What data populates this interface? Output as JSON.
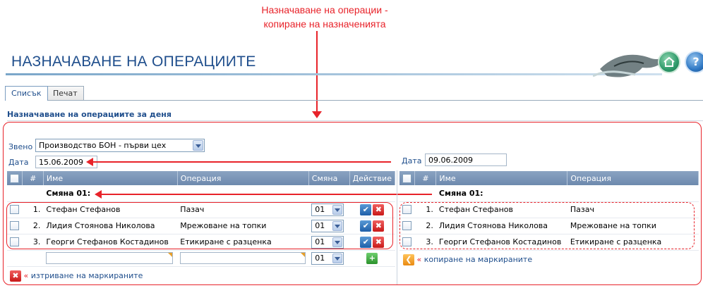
{
  "annotation": {
    "line1": "Назначаване на операции -",
    "line2": "копиране на назначенията"
  },
  "header": {
    "title": "НАЗНАЧАВАНЕ НА ОПЕРАЦИИТЕ",
    "home_icon": "home-icon",
    "help_icon": "?"
  },
  "tabs": [
    {
      "label": "Списък",
      "active": true
    },
    {
      "label": "Печат",
      "active": false
    }
  ],
  "section_title": "Назначаване на операциите за деня",
  "filters": {
    "unit_label": "Звено",
    "unit_value": "Производство БОН - първи цех",
    "date_label": "Дата",
    "date_value": "15.06.2009"
  },
  "left_table": {
    "columns": [
      "#",
      "Име",
      "Операция",
      "Смяна",
      "Действие"
    ],
    "group_label": "Смяна 01:",
    "rows": [
      {
        "num": "1.",
        "name": "Стефан Стефанов",
        "operation": "Пазач",
        "shift": "01"
      },
      {
        "num": "2.",
        "name": "Лидия Стоянова Николова",
        "operation": "Мрежоване на топки",
        "shift": "01"
      },
      {
        "num": "3.",
        "name": "Георги Стефанов Костадинов",
        "operation": "Етикиране с разценка",
        "shift": "01"
      }
    ],
    "new_row_shift": "01",
    "delete_link": "изтриване на маркираните",
    "quote": "«"
  },
  "right_panel": {
    "date_label": "Дата",
    "date_value": "09.06.2009",
    "columns": [
      "#",
      "Име",
      "Операция"
    ],
    "group_label": "Смяна 01:",
    "rows": [
      {
        "num": "1.",
        "name": "Стефан Стефанов",
        "operation": "Пазач"
      },
      {
        "num": "2.",
        "name": "Лидия Стоянова Николова",
        "operation": "Мрежоване на топки"
      },
      {
        "num": "3.",
        "name": "Георги Стефанов Костадинов",
        "operation": "Етикиране с разценка"
      }
    ],
    "copy_link": "копиране на маркираните",
    "quote": "«"
  },
  "colors": {
    "accent": "#1f4e8c",
    "annotation": "#e8232a",
    "header_bg": "#7a93b5"
  }
}
